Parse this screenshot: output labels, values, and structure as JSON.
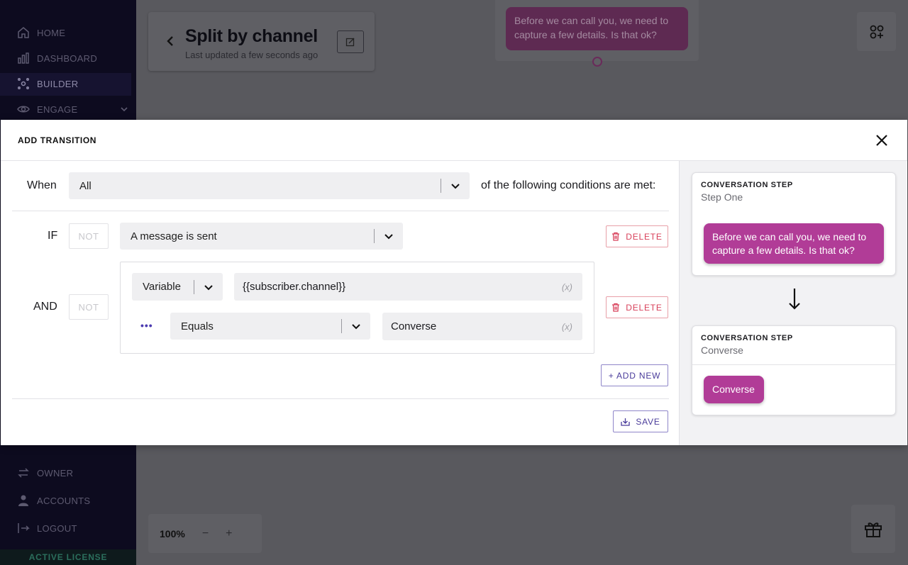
{
  "sidebar": {
    "items": [
      {
        "label": "HOME",
        "icon": "home-icon"
      },
      {
        "label": "DASHBOARD",
        "icon": "bar-chart-icon"
      },
      {
        "label": "BUILDER",
        "icon": "builder-icon"
      },
      {
        "label": "ENGAGE",
        "icon": "eye-icon"
      },
      {
        "label": "OWNER",
        "icon": "transfer-icon"
      },
      {
        "label": "ACCOUNTS",
        "icon": "user-icon"
      },
      {
        "label": "LOGOUT",
        "icon": "logout-icon"
      }
    ],
    "license_label": "ACTIVE LICENSE"
  },
  "canvas": {
    "flow_title": "Split by channel",
    "flow_subtitle": "Last updated a few seconds ago",
    "step_bubble_text": "Before we can call you, we need to capture a few details. Is that ok?",
    "zoom_level": "100%",
    "zoom_out": "−",
    "zoom_in": "+"
  },
  "modal": {
    "title": "ADD TRANSITION",
    "when_label": "When",
    "match_select": "All",
    "match_suffix": "of the following conditions are met:",
    "conditions": [
      {
        "label": "IF",
        "not_label": "NOT",
        "trigger_select": "A message is sent",
        "delete_label": "DELETE"
      },
      {
        "label": "AND",
        "not_label": "NOT",
        "type_select": "Variable",
        "variable_value": "{{subscriber.channel}}",
        "variable_hint": "(x)",
        "more_label": "•••",
        "operator_select": "Equals",
        "compare_value": "Converse",
        "compare_hint": "(x)",
        "delete_label": "DELETE"
      }
    ],
    "add_new_label": "+ ADD NEW",
    "save_label": "SAVE"
  },
  "preview": {
    "from_step": {
      "header": "CONVERSATION STEP",
      "name": "Step One",
      "message": "Before we can call you, we need to capture a few details. Is that ok?"
    },
    "to_step": {
      "header": "CONVERSATION STEP",
      "name": "Converse",
      "message": "Converse"
    }
  },
  "colors": {
    "accent_purple": "#4a3c9b",
    "message_pink": "#b13c97",
    "delete_red": "#d8405a",
    "sidebar_bg": "#0d0b1f"
  }
}
